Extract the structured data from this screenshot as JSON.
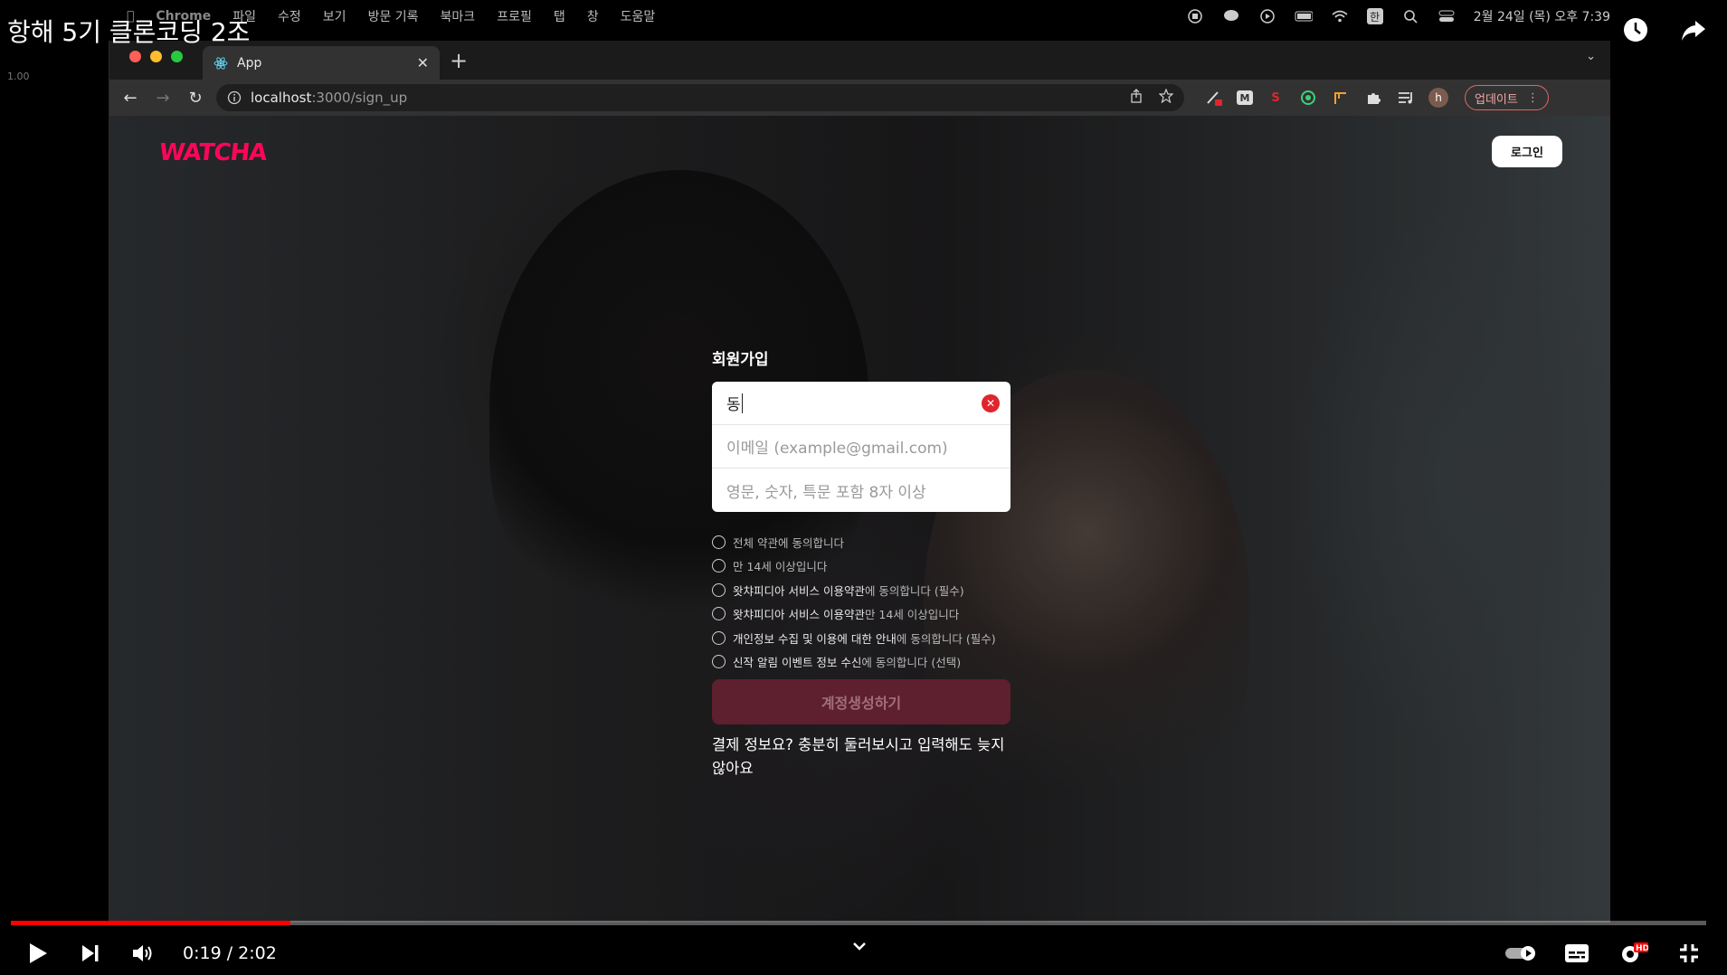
{
  "video": {
    "title": "항해 5기 클론코딩 2조",
    "speed_readout": "1.00",
    "progress": 0.165,
    "current_time": "0:19",
    "duration": "2:02",
    "time_separator": " / "
  },
  "mac_menu": {
    "app_name": "Chrome",
    "items": [
      "파일",
      "수정",
      "보기",
      "방문 기록",
      "북마크",
      "프로필",
      "탭",
      "창",
      "도움말"
    ],
    "clock": "2월 24일 (목) 오후 7:39",
    "input_source": "한"
  },
  "browser": {
    "tab_title": "App",
    "url_host": "localhost",
    "url_path": ":3000/sign_up",
    "profile_initial": "h",
    "update_label": "업데이트"
  },
  "page": {
    "logo": "WATCHA",
    "login_label": "로그인",
    "signup_title": "회원가입",
    "name_value": "동",
    "email_placeholder": "이메일 (example@gmail.com)",
    "password_placeholder": "영문, 숫자, 특문 포함 8자 이상",
    "agreements": [
      {
        "strong": "",
        "text": "전체 약관에 동의합니다"
      },
      {
        "strong": "",
        "text": "만 14세 이상입니다"
      },
      {
        "strong": "왓챠피디아 서비스 이용약관",
        "text": "에 동의합니다 (필수)"
      },
      {
        "strong": "왓챠피디아 서비스 이용약관",
        "text": "만 14세 이상입니다"
      },
      {
        "strong": "개인정보 수집 및 이용에 대한 안내",
        "text": "에 동의합니다 (필수)"
      },
      {
        "strong": "신작 알림 이벤트 정보 수신",
        "text": "에 동의합니다 (선택)"
      }
    ],
    "create_button": "계정생성하기",
    "payment_note": "결제 정보요? 충분히 둘러보시고 입력해도 늦지 않아요"
  },
  "colors": {
    "brand": "#ff0558",
    "progress": "#ff0000",
    "clear_icon": "#e0252d"
  }
}
